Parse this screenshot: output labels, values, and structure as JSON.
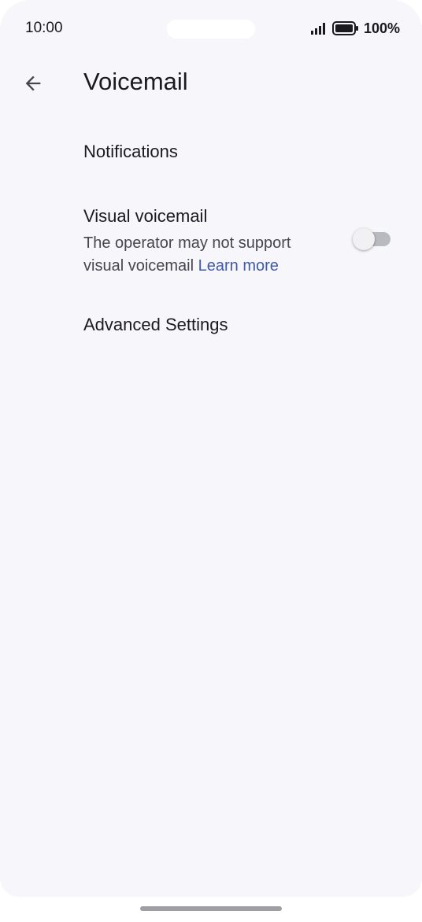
{
  "status_bar": {
    "time": "10:00",
    "battery": "100%",
    "icons": [
      "signal-icon",
      "battery-icon"
    ]
  },
  "app_bar": {
    "back_icon": "arrow-back-icon",
    "title": "Voicemail"
  },
  "preferences": {
    "notifications": {
      "title": "Notifications"
    },
    "visual_voicemail": {
      "title": "Visual voicemail",
      "summary_line1": "The operator may not support",
      "summary_line2": "visual voicemail",
      "link": "Learn more",
      "enabled": false
    },
    "advanced": {
      "title": "Advanced Settings"
    }
  },
  "colors": {
    "background": "#f7f6fb",
    "link": "#3f5aa8",
    "text_primary": "#1b1b1f",
    "text_secondary": "#46464f",
    "toggle_track_off": "#b9b9c0"
  }
}
